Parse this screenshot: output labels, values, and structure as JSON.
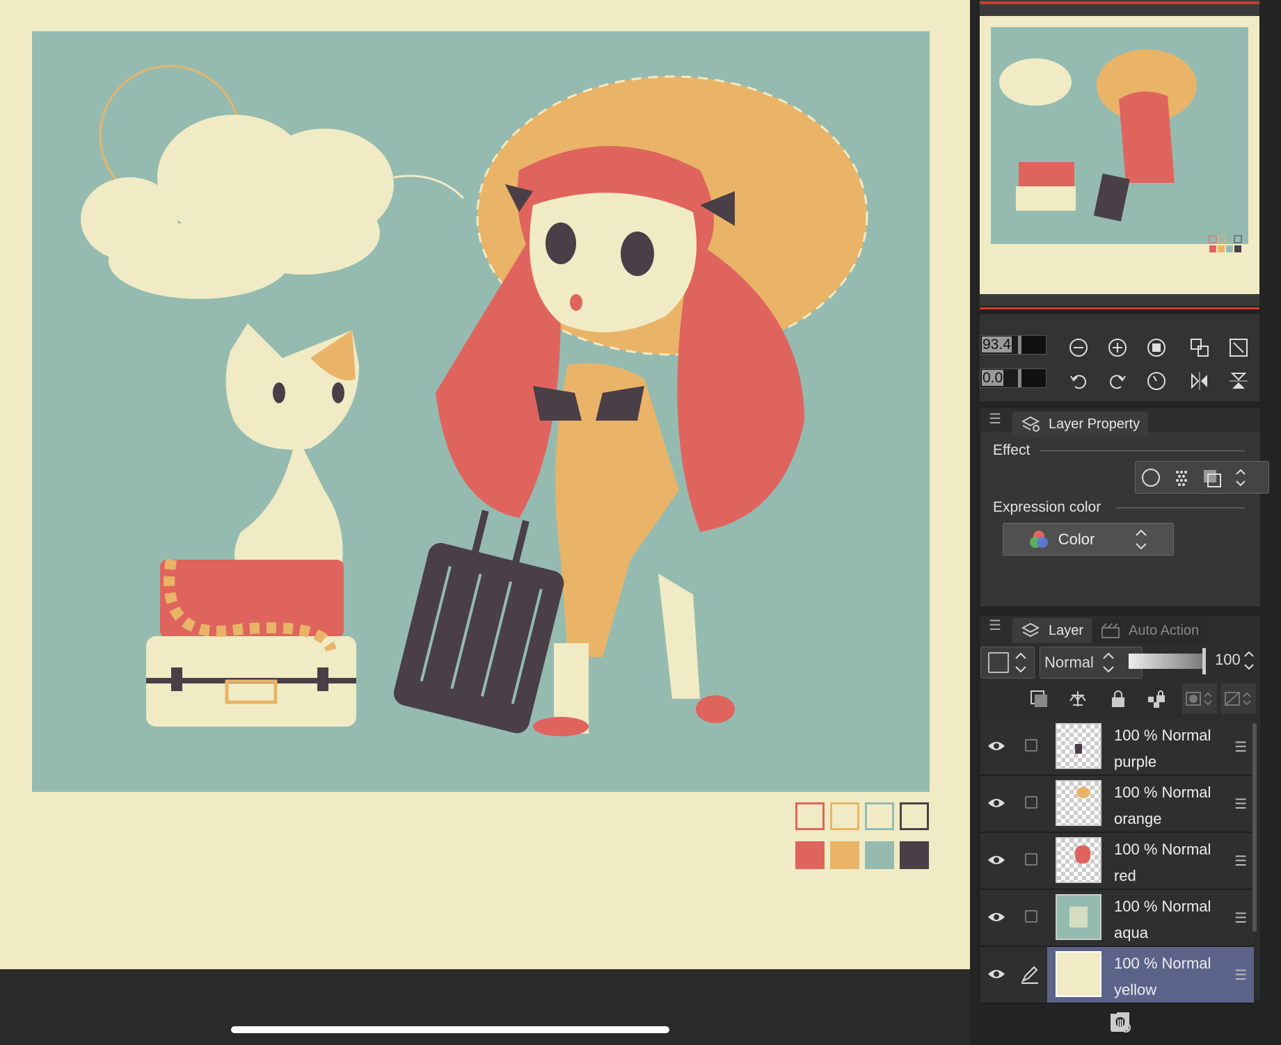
{
  "canvas": {
    "bg_color": "#f0ebc4",
    "art_bg_color": "#95bbb1"
  },
  "palette": {
    "outline_colors": [
      "#e0645e",
      "#e9b467",
      "#95bbb1",
      "#4a3f47"
    ],
    "fill_colors": [
      "#e0645e",
      "#e9b467",
      "#95bbb1",
      "#4a3f47"
    ]
  },
  "navigator": {
    "zoom_value": "93.4",
    "rotate_value": "0.0",
    "zoom_icons": [
      "zoom-out-icon",
      "zoom-in-icon",
      "fit-screen-icon",
      "fit-window-icon",
      "actual-size-icon"
    ],
    "rotate_icons": [
      "rotate-left-icon",
      "rotate-right-icon",
      "reset-rotation-icon",
      "flip-horizontal-icon",
      "flip-vertical-icon"
    ]
  },
  "layer_property": {
    "tab_label": "Layer Property",
    "effect_label": "Effect",
    "expression_label": "Expression color",
    "expression_value": "Color"
  },
  "layer_panel": {
    "tab_layer": "Layer",
    "tab_auto_action": "Auto Action",
    "blend_mode": "Normal",
    "opacity": "100",
    "layers": [
      {
        "opacity_mode": "100 % Normal",
        "name": "purple",
        "selected": false
      },
      {
        "opacity_mode": "100 % Normal",
        "name": "orange",
        "selected": false
      },
      {
        "opacity_mode": "100 % Normal",
        "name": "red",
        "selected": false
      },
      {
        "opacity_mode": "100 % Normal",
        "name": "aqua",
        "selected": false
      },
      {
        "opacity_mode": "100 % Normal",
        "name": "yellow",
        "selected": true
      }
    ]
  }
}
